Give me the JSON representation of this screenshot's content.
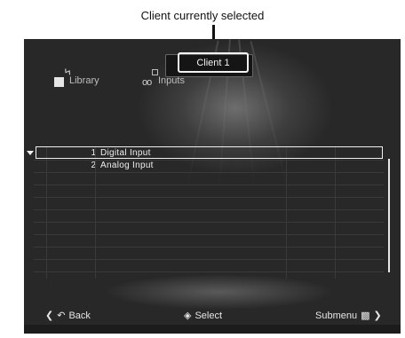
{
  "callout": {
    "text": "Client currently selected"
  },
  "header": {
    "client_label": "Client 1"
  },
  "tabs": [
    {
      "label": "Library",
      "icon": "library-icon"
    },
    {
      "label": "Inputs",
      "icon": "inputs-icon"
    }
  ],
  "list": {
    "items": [
      {
        "number": "1",
        "label": "Digital Input",
        "selected": true
      },
      {
        "number": "2",
        "label": "Analog Input",
        "selected": false
      }
    ]
  },
  "footer": {
    "back_label": "Back",
    "select_label": "Select",
    "submenu_label": "Submenu"
  }
}
